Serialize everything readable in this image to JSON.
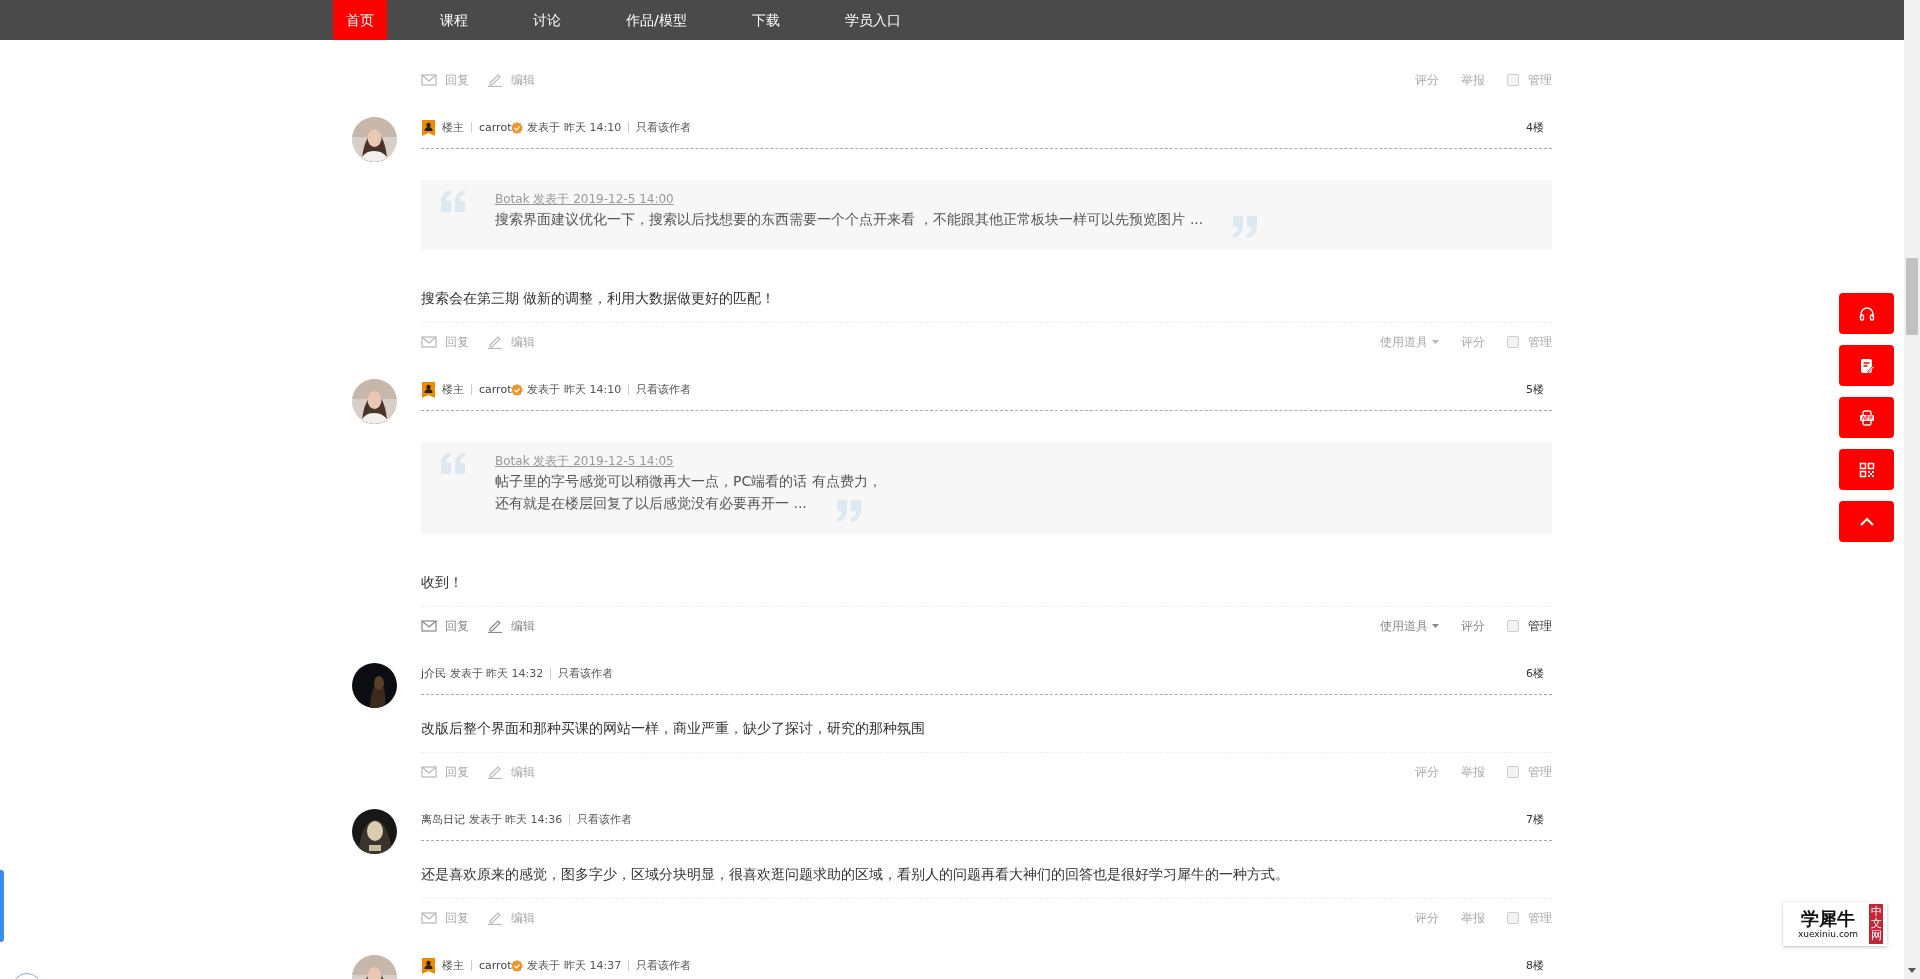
{
  "nav": {
    "items": [
      {
        "label": "首页",
        "selected": true
      },
      {
        "label": "课程",
        "selected": false
      },
      {
        "label": "讨论",
        "selected": false
      },
      {
        "label": "作品/模型",
        "selected": false
      },
      {
        "label": "下载",
        "selected": false
      },
      {
        "label": "学员入口",
        "selected": false
      }
    ]
  },
  "previous_actions": {
    "highlighted": false,
    "left": [
      {
        "kind": "reply",
        "label": "回复"
      },
      {
        "kind": "edit",
        "label": "编辑"
      }
    ],
    "right": [
      {
        "kind": "text",
        "label": "评分"
      },
      {
        "kind": "text",
        "label": "举报"
      },
      {
        "kind": "manage",
        "label": "管理",
        "checked": false
      }
    ]
  },
  "floors": [
    {
      "op_label": "楼主",
      "author": "carrot",
      "verified": true,
      "posted": "发表于 昨天 14:10",
      "author_only": "只看该作者",
      "floor": "4楼",
      "quote": {
        "title": "Botak 发表于 2019-12-5 14:00",
        "lines": [
          "搜索界面建议优化一下，搜索以后找想要的东西需要一个个点开来看 ，不能跟其他正常板块一样可以先预览图片 ..."
        ]
      },
      "message": "搜索会在第三期 做新的调整，利用大数据做更好的匹配！",
      "actions": {
        "highlighted": false,
        "left": [
          {
            "kind": "reply",
            "label": "回复"
          },
          {
            "kind": "edit",
            "label": "编辑"
          }
        ],
        "right": [
          {
            "kind": "dropdown",
            "label": "使用道具"
          },
          {
            "kind": "text",
            "label": "评分"
          },
          {
            "kind": "manage",
            "label": "管理",
            "checked": false
          }
        ]
      }
    },
    {
      "op_label": "楼主",
      "author": "carrot",
      "verified": true,
      "posted": "发表于 昨天 14:10",
      "author_only": "只看该作者",
      "floor": "5楼",
      "quote": {
        "title": "Botak 发表于 2019-12-5 14:05",
        "lines": [
          "帖子里的字号感觉可以稍微再大一点，PC端看的话  有点费力，",
          "还有就是在楼层回复了以后感觉没有必要再开一 ..."
        ]
      },
      "message": "收到！",
      "actions": {
        "highlighted": true,
        "left": [
          {
            "kind": "reply",
            "label": "回复"
          },
          {
            "kind": "edit",
            "label": "编辑"
          }
        ],
        "right": [
          {
            "kind": "dropdown",
            "label": "使用道具"
          },
          {
            "kind": "text",
            "label": "评分"
          },
          {
            "kind": "manage",
            "label": "管理",
            "checked": false
          }
        ]
      }
    },
    {
      "author": "j介民",
      "verified": false,
      "posted": "发表于 昨天 14:32",
      "author_only": "只看该作者",
      "floor": "6楼",
      "message": "改版后整个界面和那种买课的网站一样，商业严重，缺少了探讨，研究的那种氛围",
      "actions": {
        "highlighted": false,
        "left": [
          {
            "kind": "reply",
            "label": "回复"
          },
          {
            "kind": "edit",
            "label": "编辑"
          }
        ],
        "right": [
          {
            "kind": "text",
            "label": "评分"
          },
          {
            "kind": "text",
            "label": "举报"
          },
          {
            "kind": "manage",
            "label": "管理",
            "checked": false
          }
        ]
      }
    },
    {
      "author": "离岛日记",
      "verified": false,
      "posted": "发表于 昨天 14:36",
      "author_only": "只看该作者",
      "floor": "7楼",
      "message": "还是喜欢原来的感觉，图多字少，区域分块明显，很喜欢逛问题求助的区域，看别人的问题再看大神们的回答也是很好学习犀牛的一种方式。",
      "actions": {
        "highlighted": false,
        "left": [
          {
            "kind": "reply",
            "label": "回复"
          },
          {
            "kind": "edit",
            "label": "编辑"
          }
        ],
        "right": [
          {
            "kind": "text",
            "label": "评分"
          },
          {
            "kind": "text",
            "label": "举报"
          },
          {
            "kind": "manage",
            "label": "管理",
            "checked": false
          }
        ]
      }
    },
    {
      "op_label": "楼主",
      "author": "carrot",
      "verified": true,
      "posted": "发表于 昨天 14:37",
      "author_only": "只看该作者",
      "floor": "8楼"
    }
  ],
  "side_buttons": [
    {
      "kind": "headset"
    },
    {
      "kind": "note"
    },
    {
      "kind": "app"
    },
    {
      "kind": "qrcode"
    },
    {
      "kind": "top"
    }
  ],
  "logo": {
    "name": "学犀牛",
    "domain": "xuexiniu.com",
    "tag": "中文网"
  }
}
